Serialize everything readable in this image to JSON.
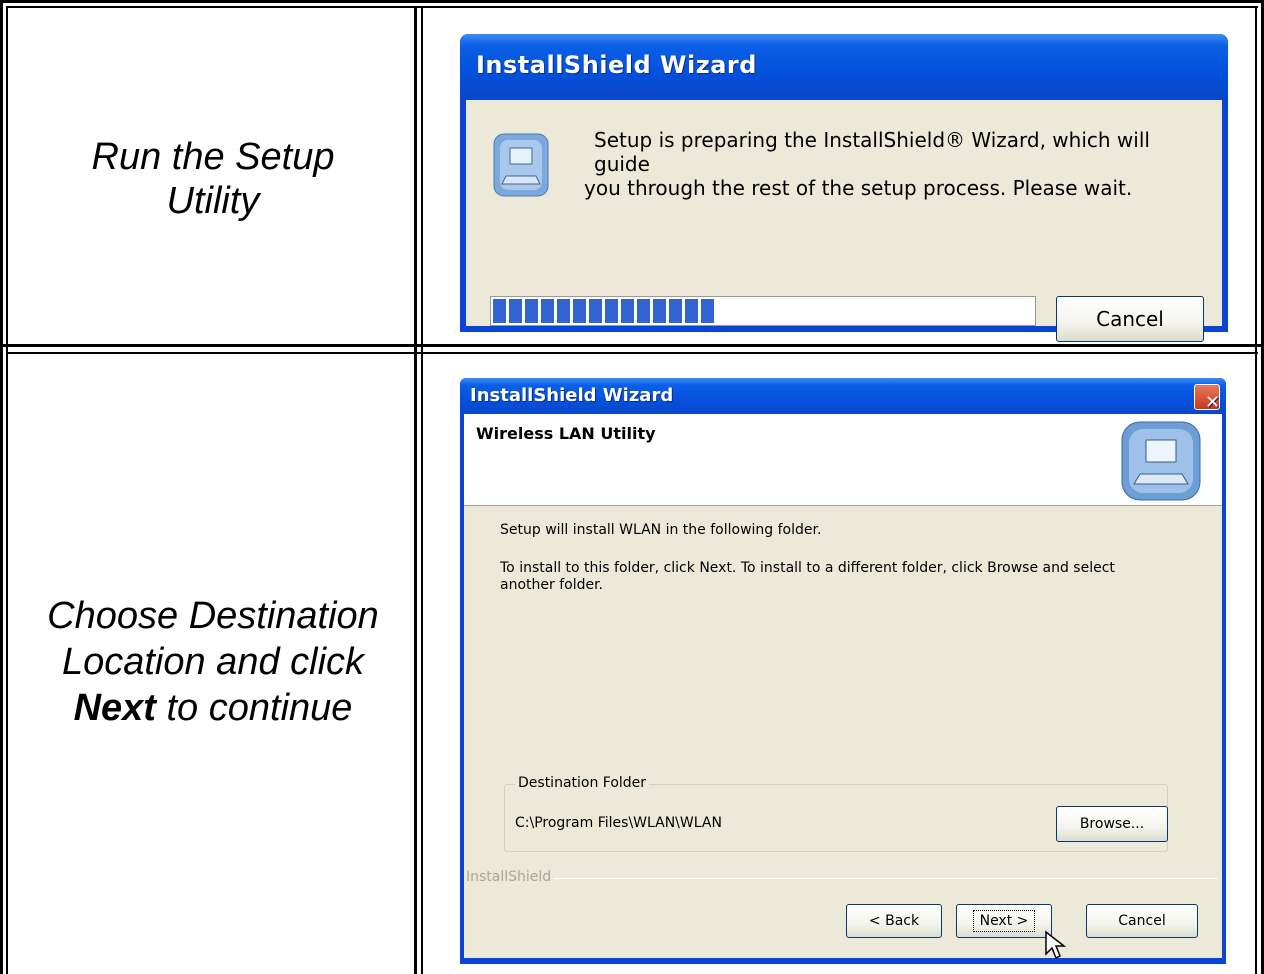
{
  "rows": [
    {
      "caption": "Run the Setup Utility",
      "dialog": {
        "title": "InstallShield Wizard",
        "message_line1": "Setup is preparing the InstallShield® Wizard, which will guide",
        "message_line2": "you through the rest of the setup process. Please wait.",
        "progress": 0.44,
        "cancel_label": "Cancel"
      }
    },
    {
      "caption_line1": "Choose Destination",
      "caption_line2": "Location and click",
      "caption_bold": "Next",
      "caption_line3_rest": " to continue",
      "dialog": {
        "title": "InstallShield Wizard",
        "close_glyph": "✕",
        "header": "Wireless LAN Utility",
        "intro": "Setup will install WLAN in the following folder.",
        "instructions_line1": "To install to this folder, click Next. To install to a different folder, click Browse and select",
        "instructions_line2": "another folder.",
        "group_label": "Destination Folder",
        "path": "C:\\Program Files\\WLAN\\WLAN",
        "browse_label": "Browse...",
        "brand": "InstallShield",
        "back_label": "< Back",
        "next_label": "Next >",
        "cancel_label": "Cancel"
      }
    }
  ],
  "colors": {
    "titlebar": "#0550dc",
    "dialog_bg": "#ece9d8",
    "progress_block": "#3264d6",
    "close_button": "#c8391a"
  },
  "icons": [
    "setup-computer-icon",
    "close-icon",
    "mouse-cursor-icon"
  ]
}
